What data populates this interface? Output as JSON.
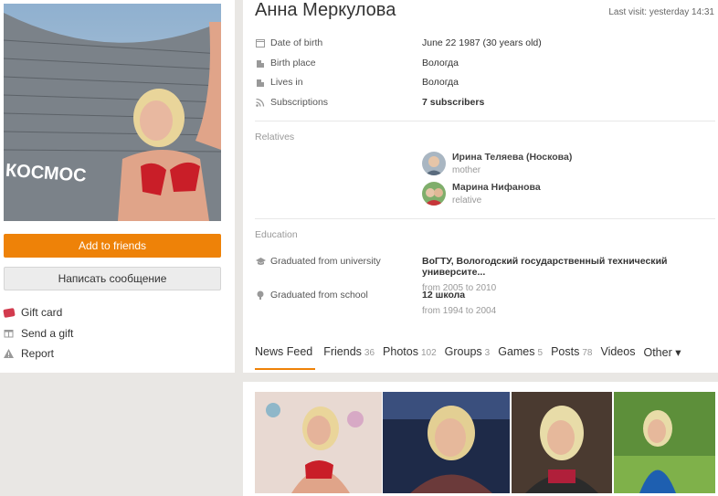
{
  "profile": {
    "name": "Анна Меркулова",
    "last_visit": "Last visit: yesterday 14:31",
    "photo_sign": "КОСМОС"
  },
  "left": {
    "add_friends": "Add to friends",
    "write_message": "Написать сообщение",
    "actions": [
      "Gift card",
      "Send a gift",
      "Report"
    ]
  },
  "info": {
    "fields": [
      {
        "label": "Date of birth",
        "value": "June 22 1987 (30 years old)"
      },
      {
        "label": "Birth place",
        "value": "Вологда"
      },
      {
        "label": "Lives in",
        "value": "Вологда"
      },
      {
        "label": "Subscriptions",
        "value": "7 subscribers"
      }
    ]
  },
  "relatives": {
    "title": "Relatives",
    "items": [
      {
        "name": "Ирина Теляева (Носкова)",
        "role": "mother"
      },
      {
        "name": "Марина Нифанова",
        "role": "relative"
      }
    ]
  },
  "education": {
    "title": "Education",
    "items": [
      {
        "label": "Graduated from university",
        "name": "ВоГТУ, Вологодский государственный технический университе...",
        "years": "from 2005 to 2010"
      },
      {
        "label": "Graduated from school",
        "name": "12 школа",
        "years": "from 1994 to 2004"
      }
    ]
  },
  "tabs": [
    {
      "label": "News Feed",
      "count": ""
    },
    {
      "label": "Friends",
      "count": "36"
    },
    {
      "label": "Photos",
      "count": "102"
    },
    {
      "label": "Groups",
      "count": "3"
    },
    {
      "label": "Games",
      "count": "5"
    },
    {
      "label": "Posts",
      "count": "78"
    },
    {
      "label": "Videos",
      "count": ""
    },
    {
      "label": "Other ▾",
      "count": ""
    }
  ],
  "colors": {
    "accent": "#ee8208",
    "gift_icon": "#d23b4e"
  }
}
